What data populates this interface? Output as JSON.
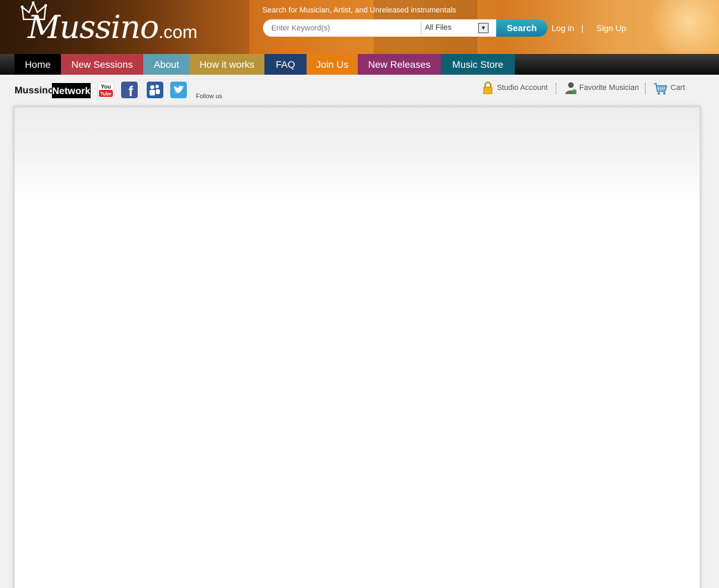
{
  "header": {
    "logo_main": "Mussino",
    "logo_suffix": ".com",
    "search_caption": "Search for Musician, Artist, and Unreleased instrumentals",
    "search_placeholder": "Enter Keyword(s)",
    "search_scope": "All Files",
    "search_button": "Search",
    "login": "Log in",
    "separator": "|",
    "signup": "Sign Up"
  },
  "nav": {
    "items": [
      {
        "label": "Home",
        "color": "#000000"
      },
      {
        "label": "New Sessions",
        "color": "#b83a45"
      },
      {
        "label": "About",
        "color": "#5f9fb4"
      },
      {
        "label": "How it works",
        "color": "#b8953b"
      },
      {
        "label": "FAQ",
        "color": "#1f3f6e"
      },
      {
        "label": "Join Us",
        "color": "#e67e12"
      },
      {
        "label": "New Releases",
        "color": "#8c2f6a"
      },
      {
        "label": "Music Store",
        "color": "#0f5f73"
      }
    ]
  },
  "network": {
    "label": "Mussino",
    "badge": "Network",
    "follow": "Follow us",
    "social_icons": [
      "youtube-icon",
      "facebook-icon",
      "myspace-icon",
      "twitter-icon"
    ]
  },
  "toplinks": {
    "studio": "Studio Account",
    "favorite": "Favorite Musician",
    "cart": "Cart"
  }
}
